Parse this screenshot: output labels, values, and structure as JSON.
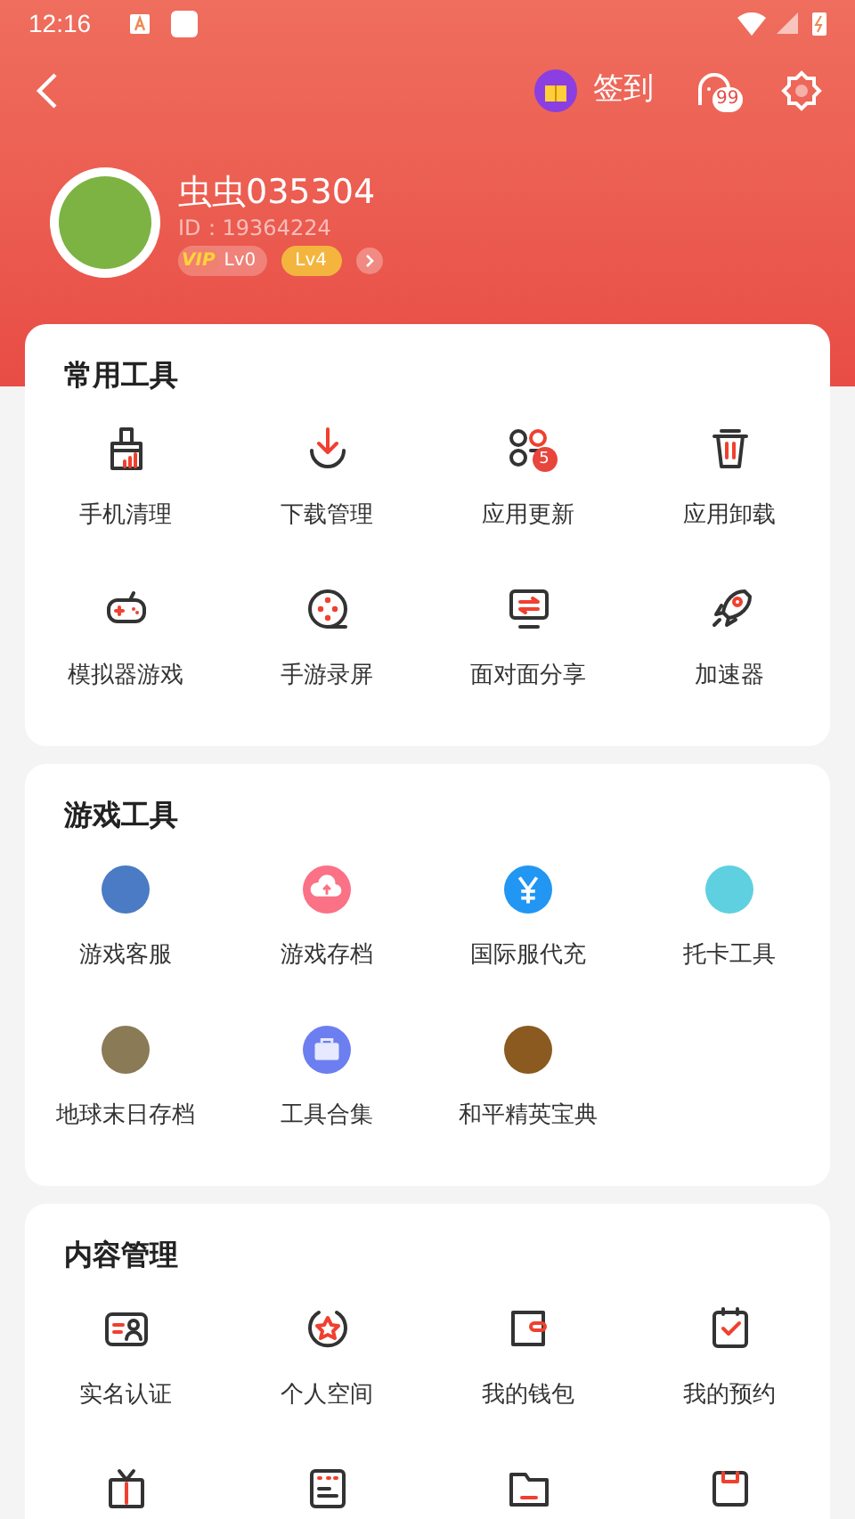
{
  "status_bar": {
    "time": "12:16"
  },
  "header": {
    "checkin_label": "签到",
    "message_badge": "99"
  },
  "profile": {
    "name": "虫虫035304",
    "id": "ID：19364224",
    "vip_label": "VIP",
    "vip_level": "Lv0",
    "level": "Lv4"
  },
  "sections": [
    {
      "title": "常用工具",
      "items": [
        {
          "label": "手机清理"
        },
        {
          "label": "下载管理"
        },
        {
          "label": "应用更新",
          "badge": "5"
        },
        {
          "label": "应用卸载"
        },
        {
          "label": "模拟器游戏"
        },
        {
          "label": "手游录屏"
        },
        {
          "label": "面对面分享"
        },
        {
          "label": "加速器"
        }
      ]
    },
    {
      "title": "游戏工具",
      "items": [
        {
          "label": "游戏客服"
        },
        {
          "label": "游戏存档"
        },
        {
          "label": "国际服代充"
        },
        {
          "label": "托卡工具"
        },
        {
          "label": "地球末日存档"
        },
        {
          "label": "工具合集"
        },
        {
          "label": "和平精英宝典"
        }
      ]
    },
    {
      "title": "内容管理",
      "items": [
        {
          "label": "实名认证"
        },
        {
          "label": "个人空间"
        },
        {
          "label": "我的钱包"
        },
        {
          "label": "我的预约"
        },
        {
          "kind": "icon_only"
        },
        {
          "kind": "icon_only"
        },
        {
          "kind": "icon_only"
        },
        {
          "kind": "icon_only"
        }
      ]
    }
  ]
}
